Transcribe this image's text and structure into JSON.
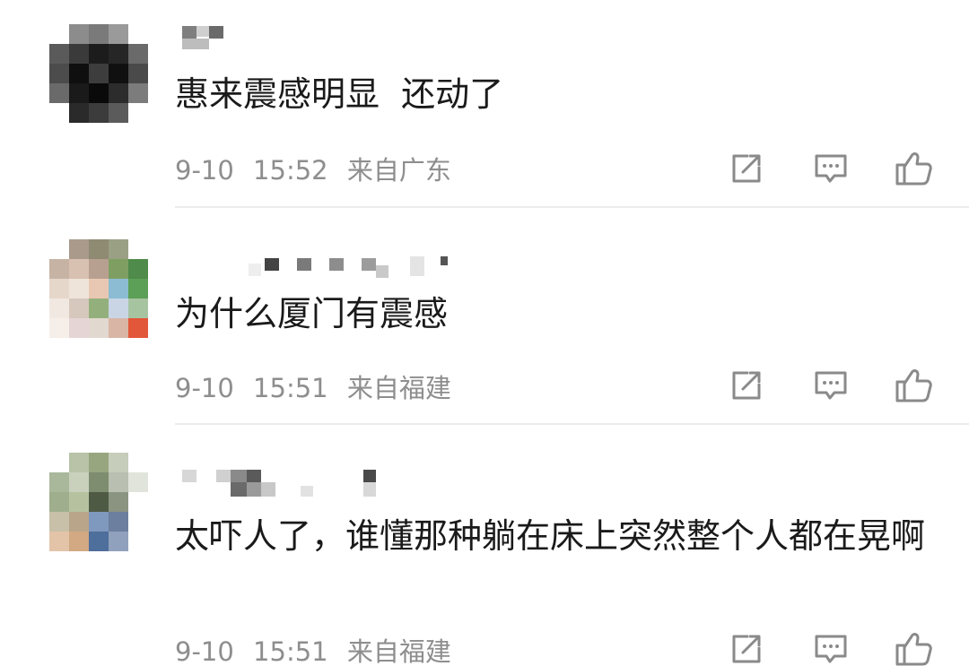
{
  "comments": [
    {
      "username_censored": true,
      "text": "惠来震感明显  还动了",
      "date": "9-10",
      "time": "15:52",
      "location": "来自广东",
      "actions": [
        "share-icon",
        "reply-icon",
        "like-icon"
      ]
    },
    {
      "username_censored": true,
      "text": "为什么厦门有震感",
      "date": "9-10",
      "time": "15:51",
      "location": "来自福建",
      "actions": [
        "share-icon",
        "reply-icon",
        "like-icon"
      ]
    },
    {
      "username_censored": true,
      "text": "太吓人了，谁懂那种躺在床上突然整个人都在晃啊",
      "date": "9-10",
      "time": "15:51",
      "location": "来自福建",
      "actions": [
        "share-icon",
        "reply-icon",
        "like-icon"
      ]
    }
  ],
  "colors": {
    "text": "#1a1a1a",
    "meta": "#8e8e8e",
    "icon": "#8a8a8a",
    "divider": "#ececec"
  }
}
